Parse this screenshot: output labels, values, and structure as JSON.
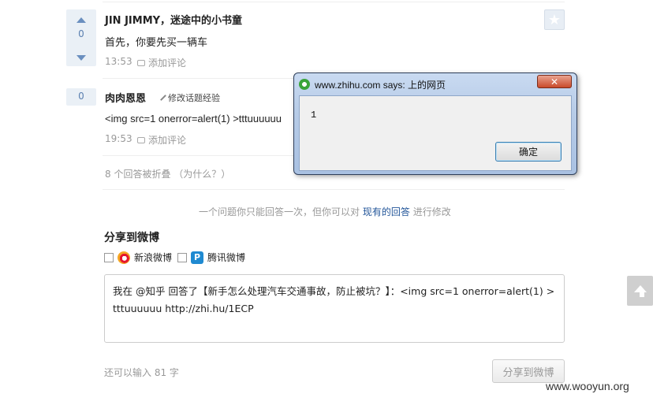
{
  "answers": [
    {
      "votes": "0",
      "author": "JIN JIMMY，迷途中的小书童",
      "text": "首先，你要先买一辆车",
      "time": "13:53",
      "comment_label": "添加评论"
    },
    {
      "votes": "0",
      "author": "肉肉恩恩",
      "edit_label": "修改话题经验",
      "text": "<img src=1 onerror=alert(1) >tttuuuuuu",
      "time": "19:53",
      "comment_label": "添加评论"
    }
  ],
  "collapsed_note": "8 个回答被折叠 （为什么？）",
  "once_note": {
    "before": "一个问题你只能回答一次，但你可以对",
    "link": "现有的回答",
    "after": "进行修改"
  },
  "share": {
    "title": "分享到微博",
    "sina_label": "新浪微博",
    "tencent_label": "腾讯微博",
    "text": "我在 @知乎 回答了【新手怎么处理汽车交通事故，防止被坑？】：<img src=1 onerror=alert(1) >tttuuuuuu http://zhi.hu/1ECP",
    "remaining": "还可以输入 81 字",
    "button": "分享到微博"
  },
  "watermark": "www.wooyun.org",
  "dialog": {
    "title": "www.zhihu.com says: 上的网页",
    "message": "1",
    "ok": "确定",
    "close": "✕"
  },
  "icons": {
    "star": "star-icon",
    "scroll_top": "arrow-up-icon",
    "sina": "sina-weibo-icon",
    "tencent": "tencent-weibo-icon",
    "ie": "ie-icon"
  }
}
